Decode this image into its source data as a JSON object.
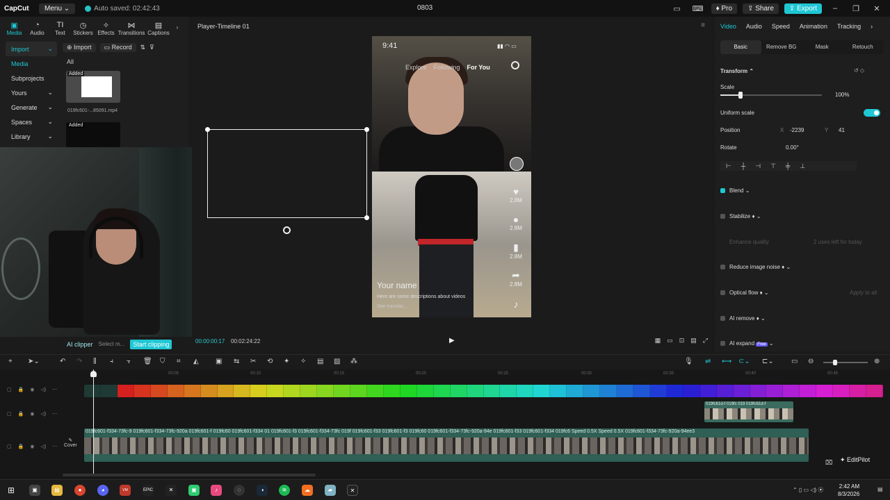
{
  "titlebar": {
    "logo": "CapCut",
    "menu": "Menu ⌄",
    "autosave": "Auto saved: 02:42:43",
    "project": "0803",
    "pro": "Pro",
    "share": "Share",
    "export": "Export"
  },
  "tool_tabs": [
    {
      "label": "Media",
      "icon": "media-icon"
    },
    {
      "label": "Audio",
      "icon": "audio-icon"
    },
    {
      "label": "Text",
      "icon": "text-icon"
    },
    {
      "label": "Stickers",
      "icon": "stickers-icon"
    },
    {
      "label": "Effects",
      "icon": "effects-icon"
    },
    {
      "label": "Transitions",
      "icon": "transitions-icon"
    },
    {
      "label": "Captions",
      "icon": "captions-icon"
    }
  ],
  "side_nav": [
    "Import",
    "Media",
    "Subprojects",
    "Yours",
    "Generate",
    "Spaces",
    "Library"
  ],
  "media": {
    "import": "Import",
    "record": "Record",
    "all": "All",
    "added": "Added",
    "file1": "019fc601-...85091.mp4"
  },
  "clip_bar": {
    "ai_clipper": "AI clipper",
    "select": "Select m...",
    "start": "Start clipping"
  },
  "player": {
    "title": "Player-Timeline 01",
    "timecode": "00:00:00:17",
    "duration": "00:02:24:22"
  },
  "phone": {
    "time": "9:41",
    "explore": "Explore",
    "following": "Following",
    "foryou": "For You",
    "likes": "2.8M",
    "comments": "2.8M",
    "saves": "2.8M",
    "shares": "2.8M",
    "name": "Your name",
    "desc": "Here are some descriptions about videos",
    "more": "See translat..."
  },
  "right_panel": {
    "tabs": [
      "Video",
      "Audio",
      "Speed",
      "Animation",
      "Tracking"
    ],
    "subtabs": [
      "Basic",
      "Remove BG",
      "Mask",
      "Retouch"
    ],
    "transform": "Transform",
    "scale": "Scale",
    "scale_val": "100%",
    "scale_fraction": 0.2,
    "uniform": "Uniform scale",
    "position": "Position",
    "pos_x_label": "X",
    "pos_x": "-2239",
    "pos_y_label": "Y",
    "pos_y": "41",
    "rotate": "Rotate",
    "rotate_val": "0.00°",
    "blend": "Blend",
    "stabilize": "Stabilize",
    "enhance": "Enhance quality",
    "enhance_hint": "2 uses left for today",
    "reduce_noise": "Reduce image noise",
    "optical": "Optical flow",
    "apply_all": "Apply to all",
    "ai_remove": "AI remove",
    "ai_expand": "AI expand",
    "free": "Free"
  },
  "timeline": {
    "ruler": [
      "00:05",
      "00:10",
      "00:15",
      "00:20",
      "00:25",
      "00:30",
      "00:35",
      "00:40",
      "00:45"
    ],
    "overlay_label": "019fc61d-f   019fc   019   019fc61d-f",
    "main_labels": "019fc601-f334-73fc-9   019fc601-f334-73fc-920a   019fc601-f   019fc60   019fc601-f334   01   019fc601-f3   019fc601-f334-73fc   019f   019fc601-f33   019fc601-f3   019fc60   019fc601-f334-73fc-920a-94e   019fc601-f33   019fc601-f334   019fc6   Speed 0.5X   Speed 0.5X   019fc601-f334-73fc-920a-94ee3",
    "cover": "Cover",
    "editpilot": "EditPilot"
  },
  "taskbar": {
    "time": "2:42 AM",
    "date": "8/3/2026"
  },
  "colors": {
    "accent": "#1fc7d4",
    "panel": "#1e1e1e",
    "timeline": "#171717"
  }
}
